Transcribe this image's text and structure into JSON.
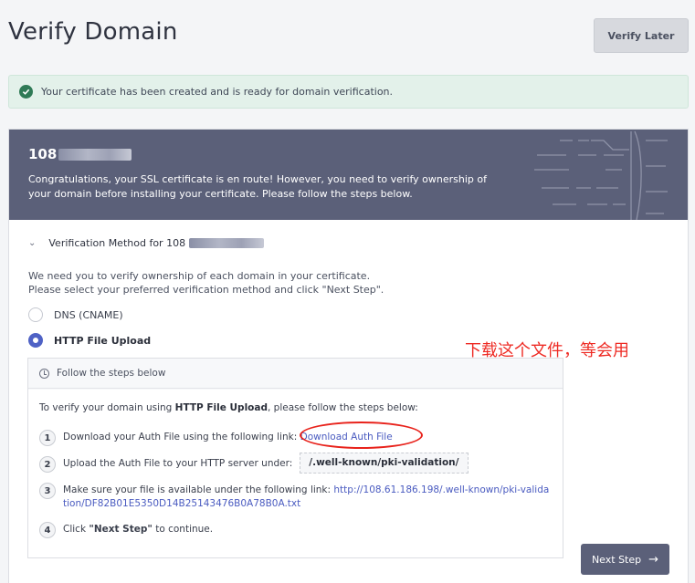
{
  "header": {
    "title": "Verify Domain",
    "verify_later": "Verify Later"
  },
  "alert": {
    "text": "Your certificate has been created and is ready for domain verification.",
    "icon": "check-circle-icon",
    "color": "#2f7a56"
  },
  "banner": {
    "domain_prefix": "108",
    "message": "Congratulations, your SSL certificate is en route! However, you need to verify ownership of your domain before installing your certificate. Please follow the steps below."
  },
  "verification": {
    "section_label": "Verification Method for 108",
    "intro_line1": "We need you to verify ownership of each domain in your certificate.",
    "intro_line2": "Please select your preferred verification method and click \"Next Step\".",
    "options": [
      {
        "label": "DNS (CNAME)",
        "selected": false
      },
      {
        "label": "HTTP File Upload",
        "selected": true
      }
    ]
  },
  "annotation": {
    "text": "下载这个文件，等会用",
    "color": "#ee2b24"
  },
  "steps": {
    "header": "Follow the steps below",
    "lead_prefix": "To verify your domain using ",
    "lead_bold": "HTTP File Upload",
    "lead_suffix": ", please follow the steps below:",
    "step1_text": "Download your Auth File using the following link:",
    "step1_link": "Download Auth File",
    "step2_text": "Upload the Auth File to your HTTP server under:",
    "step2_path": "/.well-known/pki-validation/",
    "step3_text": "Make sure your file is available under the following link:",
    "step3_link": "http://108.61.186.198/.well-known/pki-validation/DF82B01E5350D14B25143476B0A78B0A.txt",
    "step4_prefix": "Click ",
    "step4_bold": "\"Next Step\"",
    "step4_suffix": " to continue.",
    "numbers": [
      "1",
      "2",
      "3",
      "4"
    ]
  },
  "footer": {
    "next_step": "Next Step",
    "accent": "#5b6079"
  }
}
